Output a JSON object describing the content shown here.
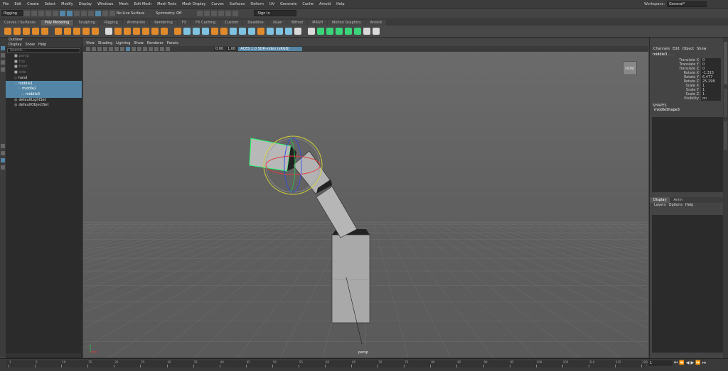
{
  "menu": [
    "File",
    "Edit",
    "Create",
    "Select",
    "Modify",
    "Display",
    "Windows",
    "Mesh",
    "Edit Mesh",
    "Mesh Tools",
    "Mesh Display",
    "Curves",
    "Surfaces",
    "Deform",
    "UV",
    "Generate",
    "Cache",
    "Arnold",
    "Help"
  ],
  "workspace": {
    "label": "Workspace:",
    "value": "General*"
  },
  "status": {
    "mode": "Rigging",
    "live_surface": "No Live Surface",
    "symmetry": "Symmetry: Off",
    "signin": "Sign In"
  },
  "shelf_tabs": [
    "Curves / Surfaces",
    "Poly Modeling",
    "Sculpting",
    "Rigging",
    "Animation",
    "Rendering",
    "FX",
    "FX Caching",
    "Custom",
    "Deadline",
    "XGen",
    "Bifrost",
    "MASH",
    "Motion Graphics",
    "Arnold"
  ],
  "shelf_active": "Poly Modeling",
  "outliner": {
    "title": "Outliner",
    "menu": [
      "Display",
      "Show",
      "Help"
    ],
    "search_placeholder": "Search...",
    "rows": [
      {
        "label": "persp",
        "dim": true,
        "indent": 0,
        "sel": false
      },
      {
        "label": "top",
        "dim": true,
        "indent": 0,
        "sel": false
      },
      {
        "label": "front",
        "dim": true,
        "indent": 0,
        "sel": false
      },
      {
        "label": "side",
        "dim": true,
        "indent": 0,
        "sel": false
      },
      {
        "label": "hand",
        "dim": false,
        "indent": 0,
        "sel": false
      },
      {
        "label": "middle1",
        "dim": false,
        "indent": 0,
        "sel": true
      },
      {
        "label": "middle2",
        "dim": false,
        "indent": 1,
        "sel": true
      },
      {
        "label": "middle3",
        "dim": false,
        "indent": 2,
        "sel": true
      },
      {
        "label": "defaultLightSet",
        "dim": false,
        "indent": 0,
        "sel": false
      },
      {
        "label": "defaultObjectSet",
        "dim": false,
        "indent": 0,
        "sel": false
      }
    ]
  },
  "panel_menu": [
    "View",
    "Shading",
    "Lighting",
    "Show",
    "Renderer",
    "Panels"
  ],
  "viewtools": {
    "val1": "0.00",
    "val2": "1.00",
    "colorspace": "ACES 1.0 SDR-video (sRGB)"
  },
  "viewport": {
    "camera_label": "persp",
    "viewcube": "FRONT"
  },
  "channel_box": {
    "menu": [
      "Channels",
      "Edit",
      "Object",
      "Show"
    ],
    "object": "middle3 . . .",
    "attrs": [
      {
        "name": "Translate X",
        "value": "0"
      },
      {
        "name": "Translate Y",
        "value": "0"
      },
      {
        "name": "Translate Z",
        "value": "0"
      },
      {
        "name": "Rotate X",
        "value": "-1.315"
      },
      {
        "name": "Rotate Y",
        "value": "6.477"
      },
      {
        "name": "Rotate Z",
        "value": "25.298"
      },
      {
        "name": "Scale X",
        "value": "1"
      },
      {
        "name": "Scale Y",
        "value": "1"
      },
      {
        "name": "Scale Z",
        "value": "1"
      },
      {
        "name": "Visibility",
        "value": "on"
      }
    ],
    "shapes_label": "SHAPES",
    "shape_name": "middleShape3"
  },
  "layers": {
    "tabs": [
      "Display",
      "Anim"
    ],
    "menu": [
      "Layers",
      "Options",
      "Help"
    ]
  },
  "timeline": {
    "ticks": [
      "1",
      "5",
      "10",
      "15",
      "20",
      "25",
      "30",
      "35",
      "40",
      "45",
      "50",
      "55",
      "60",
      "65",
      "70",
      "75",
      "80",
      "85",
      "90",
      "95",
      "100",
      "105",
      "110",
      "115",
      "120"
    ],
    "current": "1"
  }
}
